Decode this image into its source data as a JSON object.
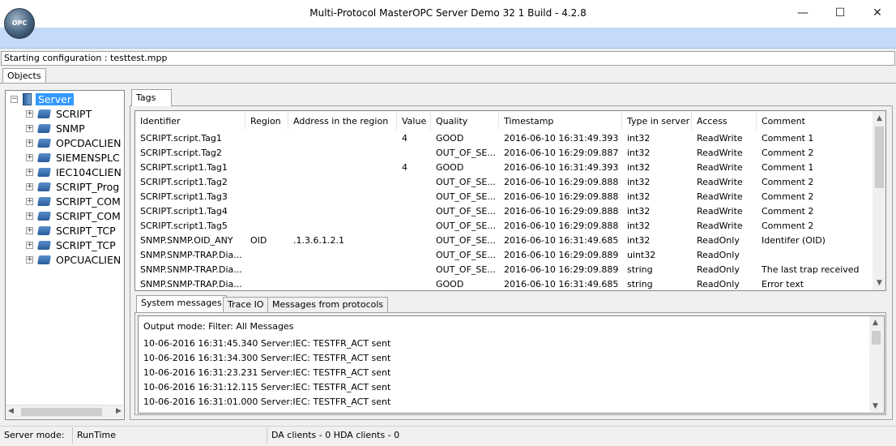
{
  "window": {
    "title": "Multi-Protocol MasterOPC Server Demo 32 1 Build - 4.2.8",
    "logo_text": "OPC",
    "minimize_glyph": "—",
    "maximize_glyph": "☐",
    "close_glyph": "✕"
  },
  "config_status": "Starting configuration : testtest.mpp",
  "objects_tab": "Objects",
  "tree": {
    "root": "Server",
    "nodes": [
      "SCRIPT",
      "SNMP",
      "OPCDACLIEN",
      "SIEMENSPLC",
      "IEC104CLIEN",
      "SCRIPT_Prog",
      "SCRIPT_COM",
      "SCRIPT_COM",
      "SCRIPT_TCP",
      "SCRIPT_TCP",
      "OPCUACLIEN"
    ]
  },
  "tags_tab": "Tags",
  "grid": {
    "columns": [
      "Identifier",
      "Region",
      "Address in the region",
      "Value",
      "Quality",
      "Timestamp",
      "Type in server",
      "Access",
      "Comment"
    ],
    "rows": [
      [
        "SCRIPT.script.Tag1",
        "",
        "",
        "4",
        "GOOD",
        "2016-06-10 16:31:49.393",
        "int32",
        "ReadWrite",
        "Comment 1"
      ],
      [
        "SCRIPT.script.Tag2",
        "",
        "",
        "",
        "OUT_OF_SE...",
        "2016-06-10 16:29:09.887",
        "int32",
        "ReadWrite",
        "Comment 2"
      ],
      [
        "SCRIPT.script1.Tag1",
        "",
        "",
        "4",
        "GOOD",
        "2016-06-10 16:31:49.393",
        "int32",
        "ReadWrite",
        "Comment 1"
      ],
      [
        "SCRIPT.script1.Tag2",
        "",
        "",
        "",
        "OUT_OF_SE...",
        "2016-06-10 16:29:09.888",
        "int32",
        "ReadWrite",
        "Comment 2"
      ],
      [
        "SCRIPT.script1.Tag3",
        "",
        "",
        "",
        "OUT_OF_SE...",
        "2016-06-10 16:29:09.888",
        "int32",
        "ReadWrite",
        "Comment 2"
      ],
      [
        "SCRIPT.script1.Tag4",
        "",
        "",
        "",
        "OUT_OF_SE...",
        "2016-06-10 16:29:09.888",
        "int32",
        "ReadWrite",
        "Comment 2"
      ],
      [
        "SCRIPT.script1.Tag5",
        "",
        "",
        "",
        "OUT_OF_SE...",
        "2016-06-10 16:29:09.888",
        "int32",
        "ReadWrite",
        "Comment 2"
      ],
      [
        "SNMP.SNMP.OID_ANY",
        "OID",
        ".1.3.6.1.2.1",
        "",
        "OUT_OF_SE...",
        "2016-06-10 16:31:49.685",
        "int32",
        "ReadOnly",
        "Identifer (OID)"
      ],
      [
        "SNMP.SNMP-TRAP.Dia...",
        "",
        "",
        "",
        "OUT_OF_SE...",
        "2016-06-10 16:29:09.889",
        "uint32",
        "ReadOnly",
        ""
      ],
      [
        "SNMP.SNMP-TRAP.Dia...",
        "",
        "",
        "",
        "OUT_OF_SE...",
        "2016-06-10 16:29:09.889",
        "string",
        "ReadOnly",
        "The last trap received"
      ],
      [
        "SNMP.SNMP-TRAP.Dia...",
        "",
        "",
        "",
        "GOOD",
        "2016-06-10 16:31:49.685",
        "string",
        "ReadOnly",
        "Error text"
      ]
    ]
  },
  "bottom_tabs": [
    "System messages",
    "Trace IO",
    "Messages from protocols"
  ],
  "messages": {
    "mode": "Output mode: Filter: All Messages",
    "lines": [
      "10-06-2016 16:31:45.340 Server:IEC: TESTFR_ACT sent",
      "10-06-2016 16:31:34.300 Server:IEC: TESTFR_ACT sent",
      "10-06-2016 16:31:23.231 Server:IEC: TESTFR_ACT sent",
      "10-06-2016 16:31:12.115 Server:IEC: TESTFR_ACT sent",
      "10-06-2016 16:31:01.000 Server:IEC: TESTFR_ACT sent"
    ]
  },
  "status": {
    "mode_label": "Server mode:",
    "mode_value": "RunTime",
    "clients": "DA clients - 0 HDA clients - 0"
  },
  "colors": {
    "menubar": "#c4daf8",
    "selection": "#3399ff"
  }
}
